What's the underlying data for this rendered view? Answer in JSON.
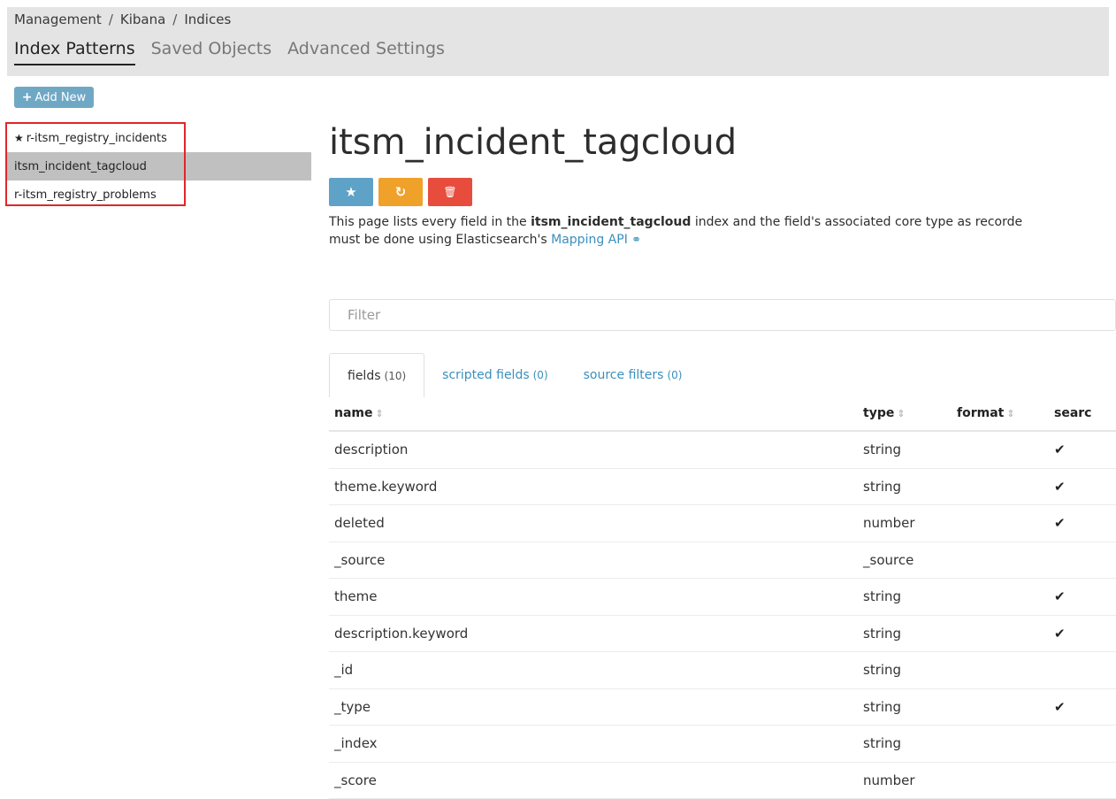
{
  "breadcrumb": {
    "part1": "Management",
    "part2": "Kibana",
    "part3": "Indices",
    "sep": "/"
  },
  "nav_tabs": [
    {
      "label": "Index Patterns"
    },
    {
      "label": "Saved Objects"
    },
    {
      "label": "Advanced Settings"
    }
  ],
  "add_new": {
    "icon": "+",
    "label": "Add New"
  },
  "sidebar": {
    "items": [
      {
        "label": "r-itsm_registry_incidents",
        "icon": "star-icon"
      },
      {
        "label": "itsm_incident_tagcloud"
      },
      {
        "label": "r-itsm_registry_problems"
      }
    ]
  },
  "index": {
    "title": "itsm_incident_tagcloud",
    "actions": {
      "favorite_icon": "★",
      "refresh_icon": "↻",
      "delete_icon": "🗑"
    },
    "description": {
      "part1": "This page lists every field in the ",
      "bold": "itsm_incident_tagcloud",
      "part2": " index and the field's associated core type as recorde",
      "part3": "must be done using Elasticsearch's ",
      "link": "Mapping API",
      "link_icon": "⚭"
    }
  },
  "filter": {
    "placeholder": "Filter"
  },
  "field_tabs": [
    {
      "label": "fields",
      "count": "(10)"
    },
    {
      "label": "scripted fields",
      "count": "(0)"
    },
    {
      "label": "source filters",
      "count": "(0)"
    }
  ],
  "table": {
    "headers": {
      "name": "name",
      "type": "type",
      "format": "format",
      "searchable": "searc"
    },
    "sort_icon": "⇕",
    "check_icon": "✔",
    "rows": [
      {
        "name": "description",
        "type": "string",
        "format": "",
        "searchable": "✔"
      },
      {
        "name": "theme.keyword",
        "type": "string",
        "format": "",
        "searchable": "✔"
      },
      {
        "name": "deleted",
        "type": "number",
        "format": "",
        "searchable": "✔"
      },
      {
        "name": "_source",
        "type": "_source",
        "format": "",
        "searchable": ""
      },
      {
        "name": "theme",
        "type": "string",
        "format": "",
        "searchable": "✔"
      },
      {
        "name": "description.keyword",
        "type": "string",
        "format": "",
        "searchable": "✔"
      },
      {
        "name": "_id",
        "type": "string",
        "format": "",
        "searchable": ""
      },
      {
        "name": "_type",
        "type": "string",
        "format": "",
        "searchable": "✔"
      },
      {
        "name": "_index",
        "type": "string",
        "format": "",
        "searchable": ""
      },
      {
        "name": "_score",
        "type": "number",
        "format": "",
        "searchable": ""
      }
    ]
  },
  "colors": {
    "accent": "#3a8fbd",
    "highlight_box": "#e1262a",
    "refresh_button": "#f0a12a",
    "delete_button": "#e74c3c"
  }
}
